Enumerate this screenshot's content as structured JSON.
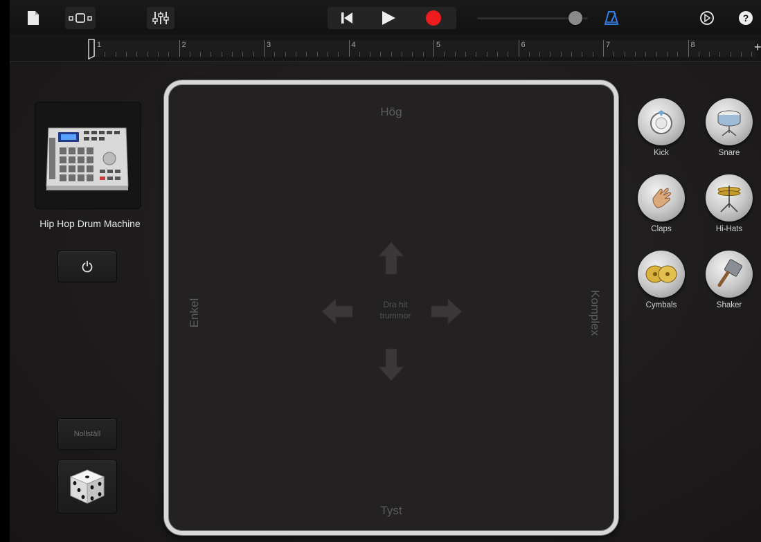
{
  "toolbar": {
    "icons": [
      "document-icon",
      "track-view-icon",
      "mixer-icon",
      "rewind-icon",
      "play-icon",
      "record-icon",
      "volume-slider",
      "metronome-icon",
      "settings-icon",
      "help-icon"
    ],
    "help_label": "?",
    "volume_level": 0.92,
    "record_color": "#ee1c1c",
    "metronome_color": "#2f7fe6"
  },
  "ruler": {
    "bars": [
      "1",
      "2",
      "3",
      "4",
      "5",
      "6",
      "7",
      "8"
    ],
    "add_label": "+"
  },
  "left_panel": {
    "instrument_name": "Hip Hop Drum Machine",
    "power_icon": "power-icon",
    "reset_label": "Nollställ",
    "dice_icon": "dice-icon"
  },
  "xy_pad": {
    "top_label": "Hög",
    "bottom_label": "Tyst",
    "left_label": "Enkel",
    "right_label": "Komplex",
    "center_line1": "Dra hit",
    "center_line2": "trummor"
  },
  "drums": [
    {
      "label": "Kick",
      "icon": "kick-drum-icon"
    },
    {
      "label": "Snare",
      "icon": "snare-drum-icon"
    },
    {
      "label": "Claps",
      "icon": "clap-hand-icon"
    },
    {
      "label": "Hi-Hats",
      "icon": "hihat-icon"
    },
    {
      "label": "Cymbals",
      "icon": "cymbals-icon"
    },
    {
      "label": "Shaker",
      "icon": "shaker-icon"
    }
  ]
}
